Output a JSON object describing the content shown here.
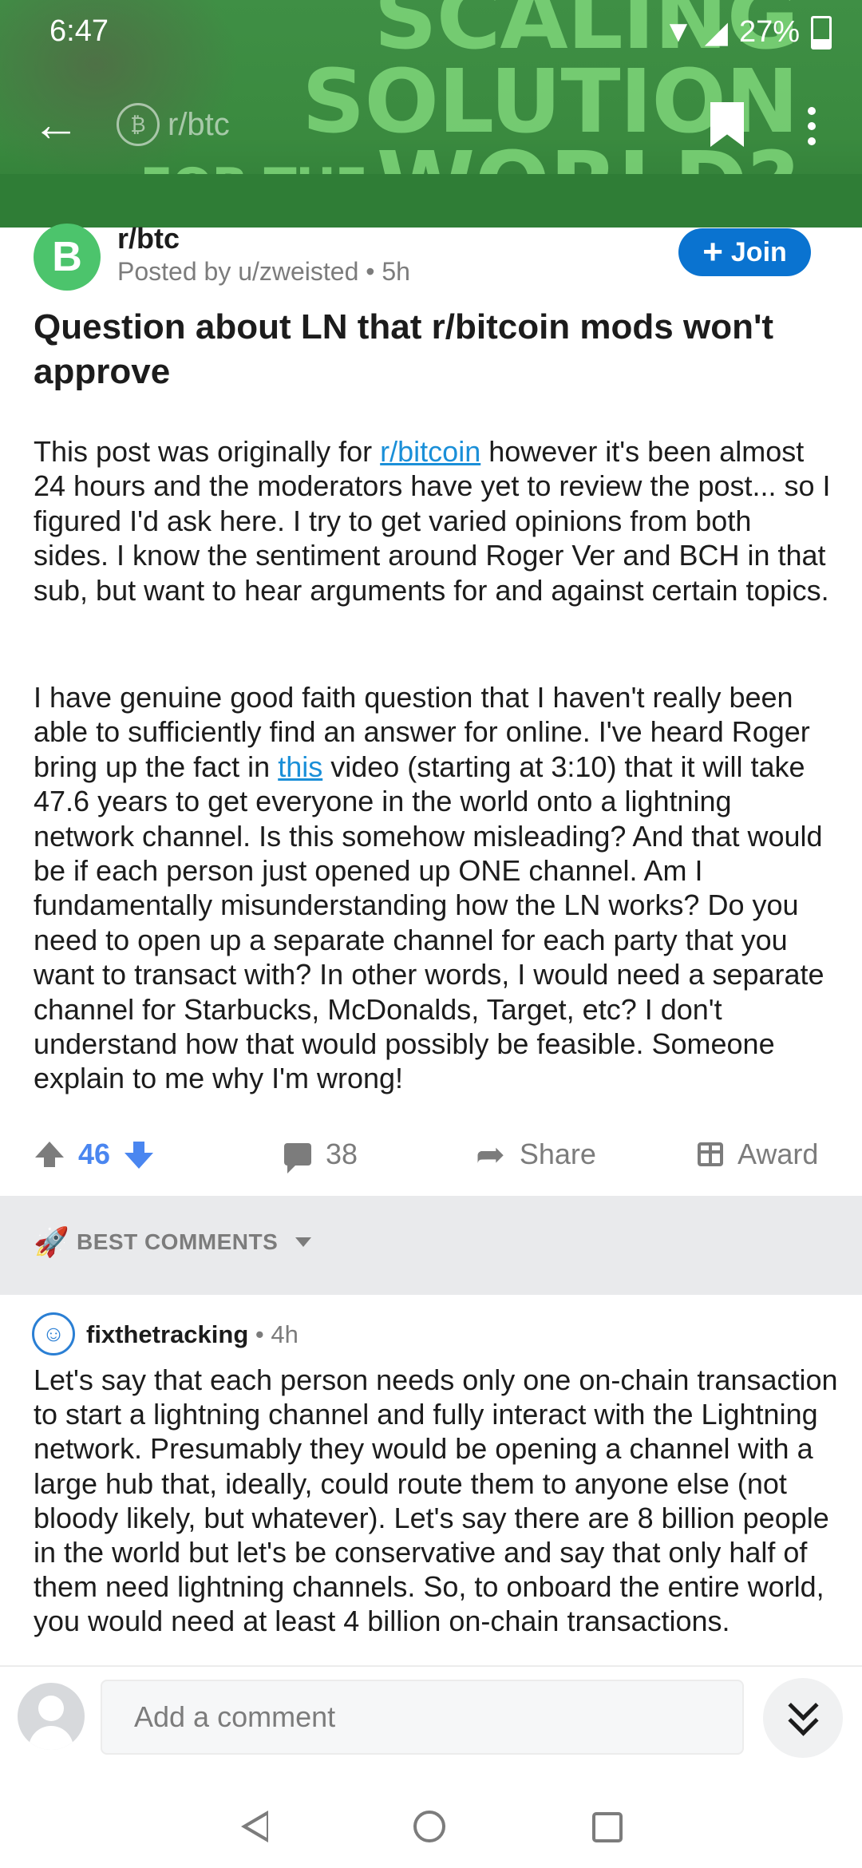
{
  "status": {
    "time": "6:47",
    "battery": "27%"
  },
  "banner": {
    "line1": "SCALING SOLUTION",
    "line2": "FOR THE",
    "line3": "WORLD?"
  },
  "header": {
    "subreddit": "r/btc"
  },
  "post": {
    "subreddit": "r/btc",
    "posted_by": "Posted by u/zweisted • 5h",
    "join_label": "Join",
    "title": "Question about LN that r/bitcoin mods won't approve",
    "p1_before": "This post was originally for ",
    "p1_link": "r/bitcoin",
    "p1_after": " however it's been almost 24 hours and the moderators have yet to review the post... so I figured I'd ask here. I try to get varied opinions from both sides. I know the sentiment around Roger Ver and BCH in that sub, but want to hear arguments for and against certain topics.",
    "p2_before": "I have genuine good faith question that I haven't really been able to sufficiently find an answer for online. I've heard Roger bring up the fact in ",
    "p2_link": "this",
    "p2_after": " video (starting at 3:10) that it will take 47.6 years to get everyone in the world onto a lightning network channel. Is this somehow misleading? And that would be if each person just opened up ONE channel. Am I fundamentally misunderstanding how the LN works? Do you need to open up a separate channel for each party that you want to transact with? In other words, I would need a separate channel for Starbucks, McDonalds, Target, etc? I don't understand how that would possibly be feasible. Someone explain to me why I'm wrong!",
    "score": "46",
    "comments": "38",
    "share_label": "Share",
    "award_label": "Award"
  },
  "sort": {
    "label": "BEST COMMENTS"
  },
  "comment": {
    "user": "fixthetracking",
    "time": " • 4h",
    "body": "Let's say that each person needs only one on-chain transaction to start a lightning channel and fully interact with the Lightning network. Presumably they would be opening a channel with a large hub that, ideally, could route them to anyone else (not bloody likely, but whatever). Let's say there are 8 billion people in the world but let's be conservative and say that only half of them need lightning channels. So, to onboard the entire world, you would need at least 4 billion on-chain transactions."
  },
  "composer": {
    "placeholder": "Add a comment"
  },
  "colors": {
    "banner": "#3a8a3f",
    "join": "#0a73d0",
    "link": "#1a8fd8",
    "upvote_score": "#4a86f0"
  }
}
